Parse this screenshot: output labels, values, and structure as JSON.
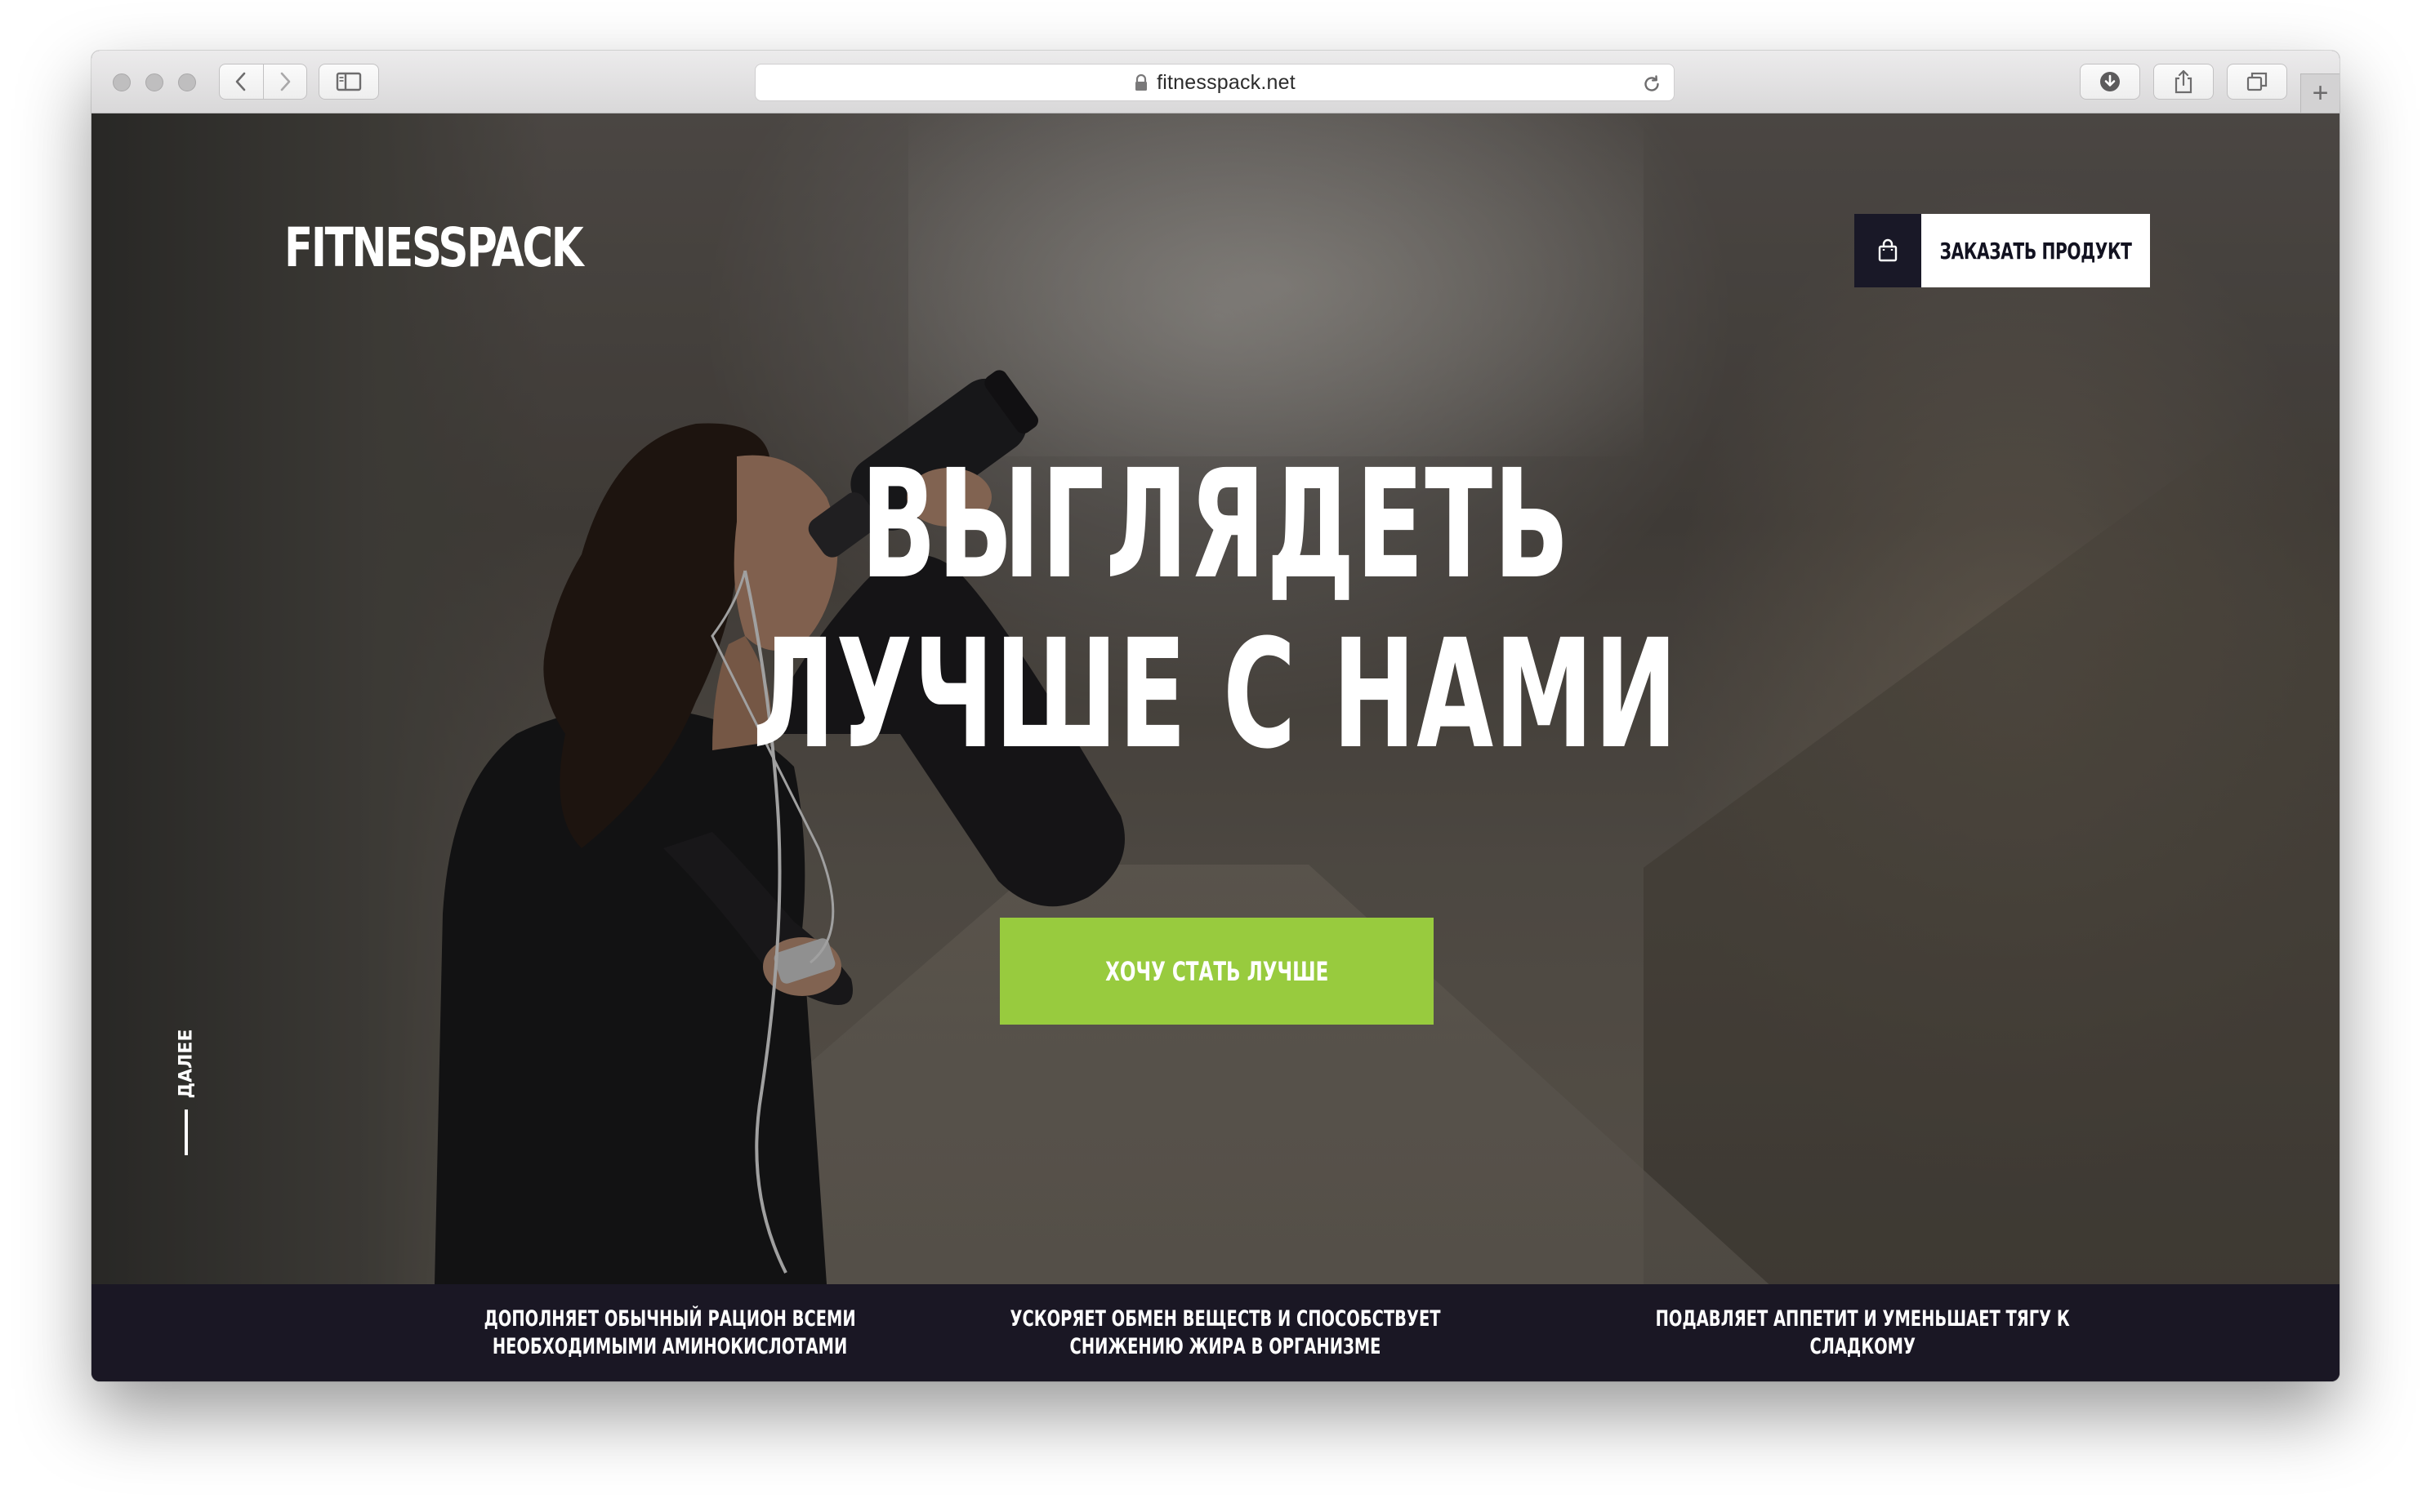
{
  "browser": {
    "url": "fitnesspack.net",
    "new_tab_label": "+",
    "icons": {
      "back": "chevron-left-icon",
      "forward": "chevron-right-icon",
      "sidebar": "sidebar-icon",
      "lock": "lock-icon",
      "reload": "reload-icon",
      "download": "download-icon",
      "share": "share-icon",
      "tabs": "tabs-icon"
    }
  },
  "header": {
    "logo": "FITNESSPACK",
    "order_button_label": "ЗАКАЗАТЬ ПРОДУКТ",
    "order_button_icon": "shopping-bag-icon"
  },
  "hero": {
    "headline_line1": "ВЫГЛЯДЕТЬ",
    "headline_line2": "ЛУЧШЕ С НАМИ",
    "cta_label": "ХОЧУ СТАТЬ ЛУЧШЕ",
    "scroll_label": "ДАЛЕЕ"
  },
  "benefits": [
    {
      "line1": "ДОПОЛНЯЕТ ОБЫЧНЫЙ РАЦИОН ВСЕМИ",
      "line2": "НЕОБХОДИМЫМИ АМИНОКИСЛОТАМИ"
    },
    {
      "line1": "УСКОРЯЕТ ОБМЕН ВЕЩЕСТВ И СПОСОБСТВУЕТ",
      "line2": "СНИЖЕНИЮ ЖИРА В ОРГАНИЗМЕ"
    },
    {
      "line1": "ПОДАВЛЯЕТ АППЕТИТ И УМЕНЬШАЕТ ТЯГУ К",
      "line2": "СЛАДКОМУ"
    }
  ],
  "colors": {
    "accent_green": "#98cb3e",
    "dark_navy": "#1a1724",
    "text_white": "#ffffff"
  }
}
